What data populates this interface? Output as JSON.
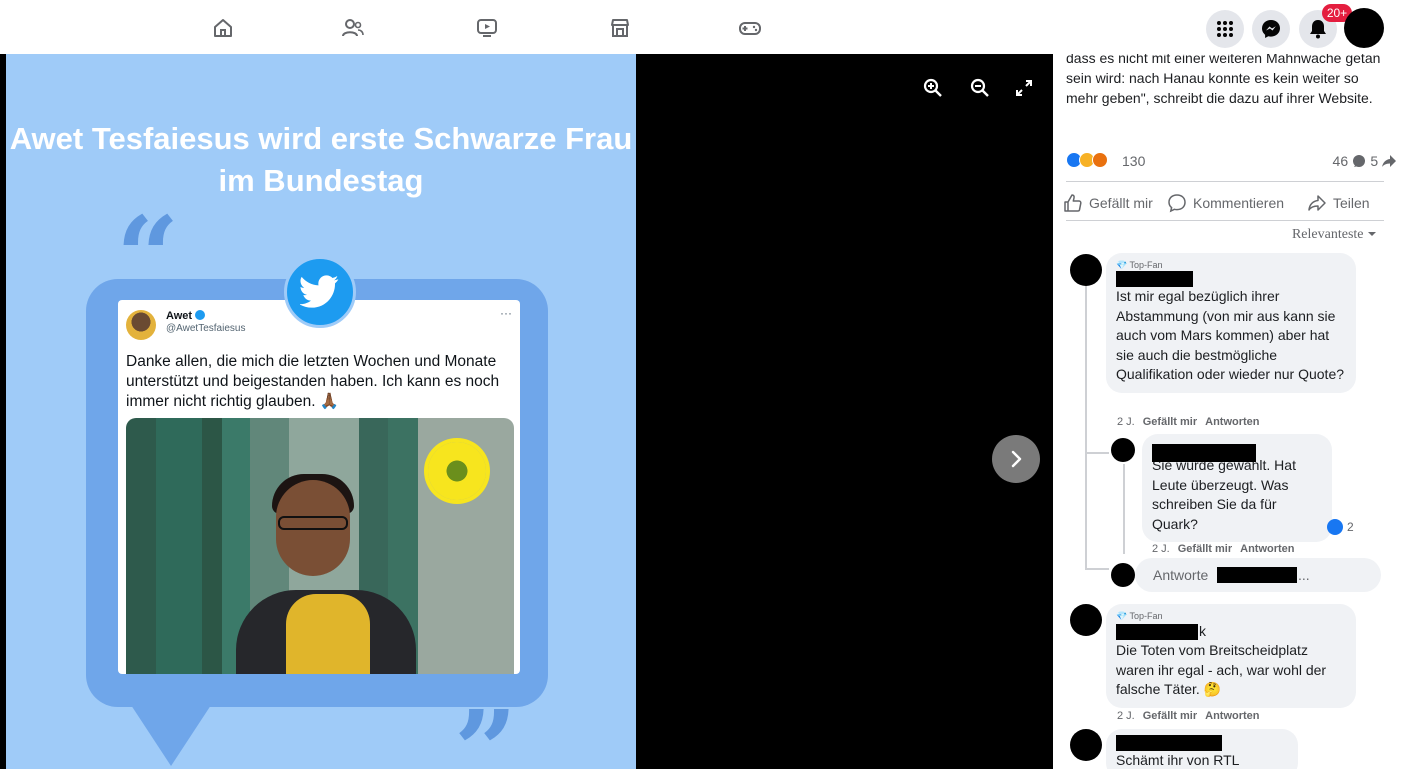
{
  "topnav": {
    "icons": [
      "home-icon",
      "friends-icon",
      "watch-icon",
      "marketplace-icon",
      "gaming-icon"
    ],
    "right": [
      "menu-grid-icon",
      "messenger-icon",
      "bell-icon"
    ],
    "notification_badge": "20+"
  },
  "viewer": {
    "headline": "Awet Tesfaiesus wird erste Schwarze Frau im Bundestag",
    "tweet": {
      "name": "Awet",
      "handle": "@AwetTesfaiesus",
      "more": "···",
      "text": "Danke allen, die mich die letzten Wochen und Monate unterstützt und beigestanden haben. Ich kann es noch immer nicht richtig glauben. 🙏🏾"
    },
    "controls": [
      "zoom-in-icon",
      "zoom-out-icon",
      "fullscreen-icon",
      "next-arrow-icon"
    ]
  },
  "panel": {
    "post_text": "dass es nicht mit einer weiteren Mahnwache getan sein wird: nach Hanau konnte es kein weiter so mehr geben\", schreibt die dazu auf ihrer Website.",
    "reaction_count": "130",
    "comment_count": "46",
    "share_count": "5",
    "actions": {
      "like": "Gefällt mir",
      "comment": "Kommentieren",
      "share": "Teilen"
    },
    "sort_label": "Relevanteste",
    "comments": [
      {
        "badge": "Top-Fan",
        "text": "Ist mir egal bezüglich ihrer Abstammung (von mir aus kann sie auch vom Mars kommen) aber hat sie auch die bestmögliche Qualifikation oder wieder nur Quote?",
        "age": "2 J.",
        "like": "Gefällt mir",
        "reply": "Antworten"
      },
      {
        "text_tail": "Sie wurde gewählt. Hat Leute überzeugt. Was schreiben Sie da für Quark?",
        "likes": "2",
        "age": "2 J.",
        "like": "Gefällt mir",
        "reply": "Antworten"
      },
      {
        "badge": "Top-Fan",
        "name_tail": "k",
        "text": "Die Toten vom Breitscheidplatz waren ihr egal - ach, war wohl der falsche Täter. 🤔",
        "age": "2 J.",
        "like": "Gefällt mir",
        "reply": "Antworten"
      },
      {
        "text": "Schämt ihr von RTL"
      }
    ],
    "reply_prompt": "Antworte",
    "reply_ellipsis": "..."
  },
  "colors": {
    "graphic_bg": "#9fcbf8",
    "bubble": "#6fa6ea",
    "twitter_blue": "#1d9bf0",
    "fb_blue": "#1877f2",
    "badge_red": "#e41e3f"
  }
}
